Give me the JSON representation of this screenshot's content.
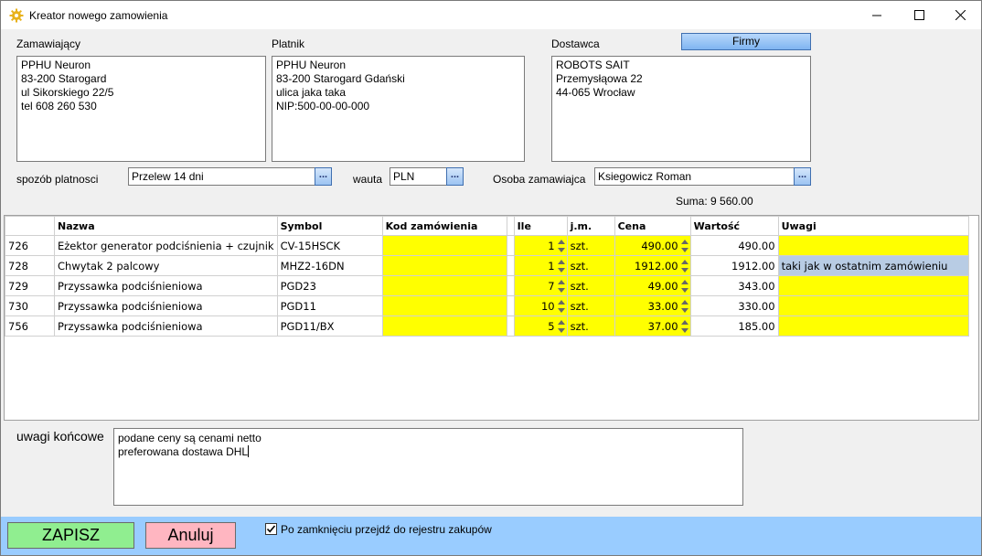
{
  "window": {
    "title": "Kreator nowego zamowienia",
    "icon": "gear-icon",
    "controls": [
      "minimize-icon",
      "maximize-icon",
      "close-icon"
    ]
  },
  "parties": {
    "ordering_label": "Zamawiający",
    "ordering_lines": [
      "PPHU Neuron",
      "83-200 Starogard",
      "ul Sikorskiego 22/5",
      "tel 608 260 530"
    ],
    "payer_label": "Platnik",
    "payer_lines": [
      "PPHU Neuron",
      "83-200 Starogard Gdański",
      "ulica jaka taka",
      "NIP:500-00-00-000"
    ],
    "supplier_label": "Dostawca",
    "supplier_lines": [
      "ROBOTS SAIT",
      "Przemysłąowa 22",
      "44-065 Wrocław"
    ],
    "firms_button": "Firmy"
  },
  "payment": {
    "method_label": "spozób platnosci",
    "method_value": "Przelew 14 dni",
    "currency_label": "wauta",
    "currency_value": "PLN",
    "person_label": "Osoba zamawiajca",
    "person_value": "Ksiegowicz Roman",
    "dots_label": "...",
    "sum_text": "Suma: 9 560.00"
  },
  "table": {
    "headers": [
      "",
      "Nazwa",
      "Symbol",
      "Kod zamówienia",
      "",
      "Ile",
      "j.m.",
      "Cena",
      "Wartość",
      "Uwagi"
    ],
    "rows": [
      {
        "id": "726",
        "name": "Eżektor generator podciśnienia + czujnik",
        "symbol": "CV-15HSCK",
        "code": "",
        "qty": "1",
        "unit": "szt.",
        "price": "490.00",
        "value": "490.00",
        "notes": ""
      },
      {
        "id": "728",
        "name": "Chwytak 2 palcowy",
        "symbol": "MHZ2-16DN",
        "code": "",
        "qty": "1",
        "unit": "szt.",
        "price": "1912.00",
        "value": "1912.00",
        "notes": "taki jak w ostatnim zamówieniu"
      },
      {
        "id": "729",
        "name": "Przyssawka podciśnieniowa",
        "symbol": "PGD23",
        "code": "",
        "qty": "7",
        "unit": "szt.",
        "price": "49.00",
        "value": "343.00",
        "notes": ""
      },
      {
        "id": "730",
        "name": "Przyssawka podciśnieniowa",
        "symbol": "PGD11",
        "code": "",
        "qty": "10",
        "unit": "szt.",
        "price": "33.00",
        "value": "330.00",
        "notes": ""
      },
      {
        "id": "756",
        "name": "Przyssawka podciśnieniowa",
        "symbol": "PGD11/BX",
        "code": "",
        "qty": "5",
        "unit": "szt.",
        "price": "37.00",
        "value": "185.00",
        "notes": ""
      }
    ]
  },
  "final_notes": {
    "label": "uwagi końcowe",
    "lines": [
      "podane ceny są cenami netto",
      "preferowana dostawa DHL"
    ]
  },
  "footer": {
    "save_button": "ZAPISZ",
    "cancel_button": "Anuluj",
    "checkbox_label": "Po zamknięciu przejdź do rejestru zakupów",
    "checkbox_checked": true
  },
  "colors": {
    "yellow_cell": "#ffff00",
    "note_cell": "#b8cce4",
    "save_bg": "#90ee90",
    "cancel_bg": "#ffb6c1",
    "footer_bg": "#99ccff"
  }
}
